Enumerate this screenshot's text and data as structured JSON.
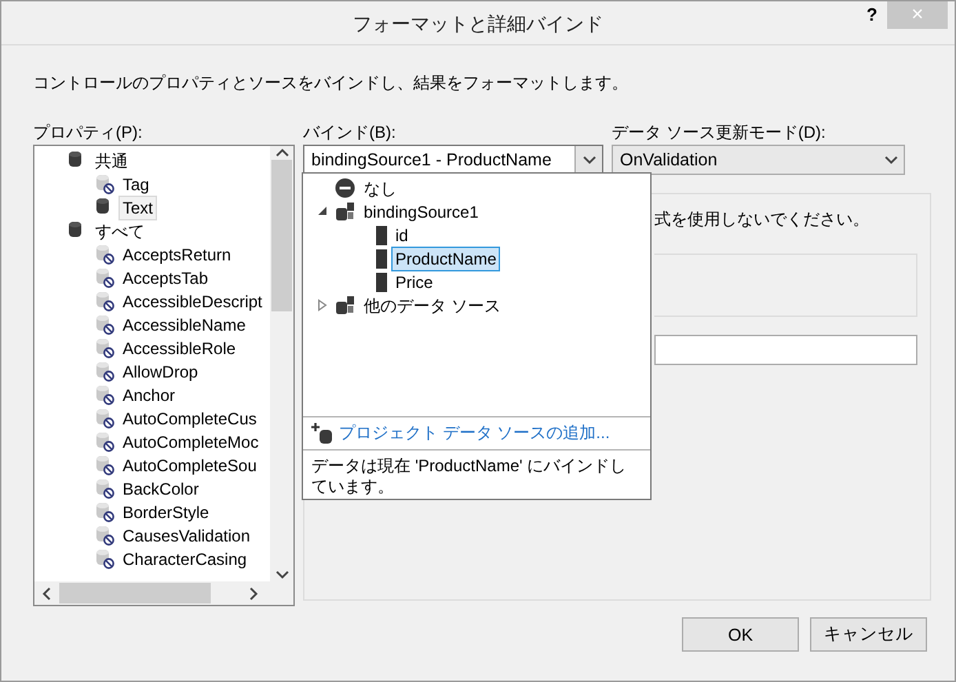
{
  "window": {
    "title": "フォーマットと詳細バインド",
    "help": "?",
    "close": "×"
  },
  "description": "コントロールのプロパティとソースをバインドし、結果をフォーマットします。",
  "properties": {
    "label": "プロパティ(P):",
    "items": [
      {
        "label": "共通",
        "kind": "category",
        "selected": false,
        "children": [
          {
            "label": "Tag",
            "kind": "unbound",
            "selected": false
          },
          {
            "label": "Text",
            "kind": "bound",
            "selected": true
          }
        ]
      },
      {
        "label": "すべて",
        "kind": "category",
        "selected": false,
        "children": [
          {
            "label": "AcceptsReturn",
            "kind": "unbound",
            "selected": false
          },
          {
            "label": "AcceptsTab",
            "kind": "unbound",
            "selected": false
          },
          {
            "label": "AccessibleDescript",
            "kind": "unbound",
            "selected": false
          },
          {
            "label": "AccessibleName",
            "kind": "unbound",
            "selected": false
          },
          {
            "label": "AccessibleRole",
            "kind": "unbound",
            "selected": false
          },
          {
            "label": "AllowDrop",
            "kind": "unbound",
            "selected": false
          },
          {
            "label": "Anchor",
            "kind": "unbound",
            "selected": false
          },
          {
            "label": "AutoCompleteCus",
            "kind": "unbound",
            "selected": false
          },
          {
            "label": "AutoCompleteMoc",
            "kind": "unbound",
            "selected": false
          },
          {
            "label": "AutoCompleteSou",
            "kind": "unbound",
            "selected": false
          },
          {
            "label": "BackColor",
            "kind": "unbound",
            "selected": false
          },
          {
            "label": "BorderStyle",
            "kind": "unbound",
            "selected": false
          },
          {
            "label": "CausesValidation",
            "kind": "unbound",
            "selected": false
          },
          {
            "label": "CharacterCasing",
            "kind": "unbound",
            "selected": false
          }
        ]
      }
    ]
  },
  "binding": {
    "label": "バインド(B):",
    "value": "bindingSource1 - ProductName",
    "expanded": true,
    "popup": {
      "items": [
        {
          "label": "なし",
          "kind": "none",
          "selected": false
        },
        {
          "label": "bindingSource1",
          "kind": "source",
          "expanded": true,
          "selected": false,
          "children": [
            {
              "label": "id",
              "kind": "field",
              "selected": false
            },
            {
              "label": "ProductName",
              "kind": "field",
              "selected": true
            },
            {
              "label": "Price",
              "kind": "field",
              "selected": false
            }
          ]
        },
        {
          "label": "他のデータ ソース",
          "kind": "source",
          "expanded": false,
          "selected": false
        }
      ],
      "add_link": "プロジェクト データ ソースの追加...",
      "status": "データは現在 'ProductName' にバインドしています。"
    }
  },
  "update_mode": {
    "label": "データ ソース更新モード(D):",
    "value": "OnValidation"
  },
  "format_panel": {
    "note": "式を使用しないでください。"
  },
  "buttons": [
    {
      "label": "OK"
    },
    {
      "label": "キャンセル"
    }
  ]
}
